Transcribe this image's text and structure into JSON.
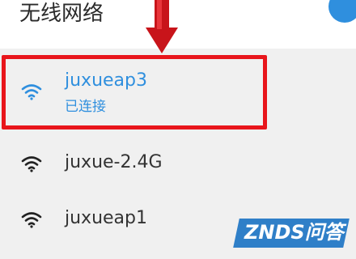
{
  "header": {
    "title": "无线网络",
    "toggle_icon": "toggle-knob"
  },
  "networks": [
    {
      "ssid": "juxueap3",
      "status": "已连接",
      "icon": "wifi-icon",
      "connected": true
    },
    {
      "ssid": "juxue-2.4G",
      "icon": "wifi-icon",
      "connected": false
    },
    {
      "ssid": "juxueap1",
      "icon": "wifi-icon",
      "connected": false
    }
  ],
  "annotation": {
    "arrow_icon": "down-arrow-icon",
    "color": "#e8151b"
  },
  "watermark": {
    "text": "ZNDS问答"
  },
  "colors": {
    "accent": "#2f8fde",
    "highlight": "#e8151b",
    "background": "#f0f0f0"
  }
}
